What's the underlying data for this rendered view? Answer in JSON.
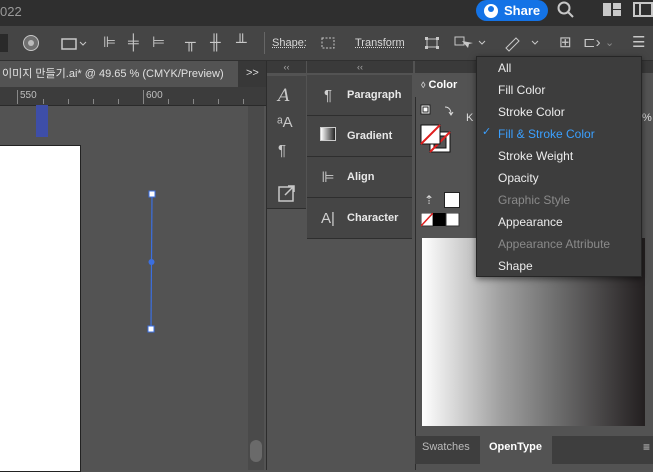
{
  "window": {
    "title_fragment": "022"
  },
  "header": {
    "share_label": "Share"
  },
  "control_bar": {
    "shape_label": "Shape:",
    "transform_label": "Transform"
  },
  "document": {
    "tab_title": "이미지 만들기.ai* @ 49.65 % (CMYK/Preview)",
    "overflow": ">>"
  },
  "ruler": {
    "labels": [
      "550",
      "600"
    ]
  },
  "panels": {
    "collapse_glyph": "‹‹",
    "paragraph": "Paragraph",
    "gradient": "Gradient",
    "align": "Align",
    "character": "Character"
  },
  "color_panel": {
    "tab_label": "Color",
    "channel_letter": "K",
    "percent": "%",
    "bottom_tabs": [
      "Swatches",
      "OpenType"
    ]
  },
  "menu": {
    "items": [
      {
        "label": "All",
        "state": "normal"
      },
      {
        "label": "Fill Color",
        "state": "normal"
      },
      {
        "label": "Stroke Color",
        "state": "normal"
      },
      {
        "label": "Fill & Stroke Color",
        "state": "selected"
      },
      {
        "label": "Stroke Weight",
        "state": "normal"
      },
      {
        "label": "Opacity",
        "state": "normal"
      },
      {
        "label": "Graphic Style",
        "state": "disabled"
      },
      {
        "label": "Appearance",
        "state": "normal"
      },
      {
        "label": "Appearance Attribute",
        "state": "disabled"
      },
      {
        "label": "Shape",
        "state": "normal"
      }
    ],
    "check_glyph": "✓"
  },
  "colors": {
    "accent": "#1473e6",
    "selected_text": "#3ba0ff",
    "selection_line": "#3b6fe0"
  }
}
